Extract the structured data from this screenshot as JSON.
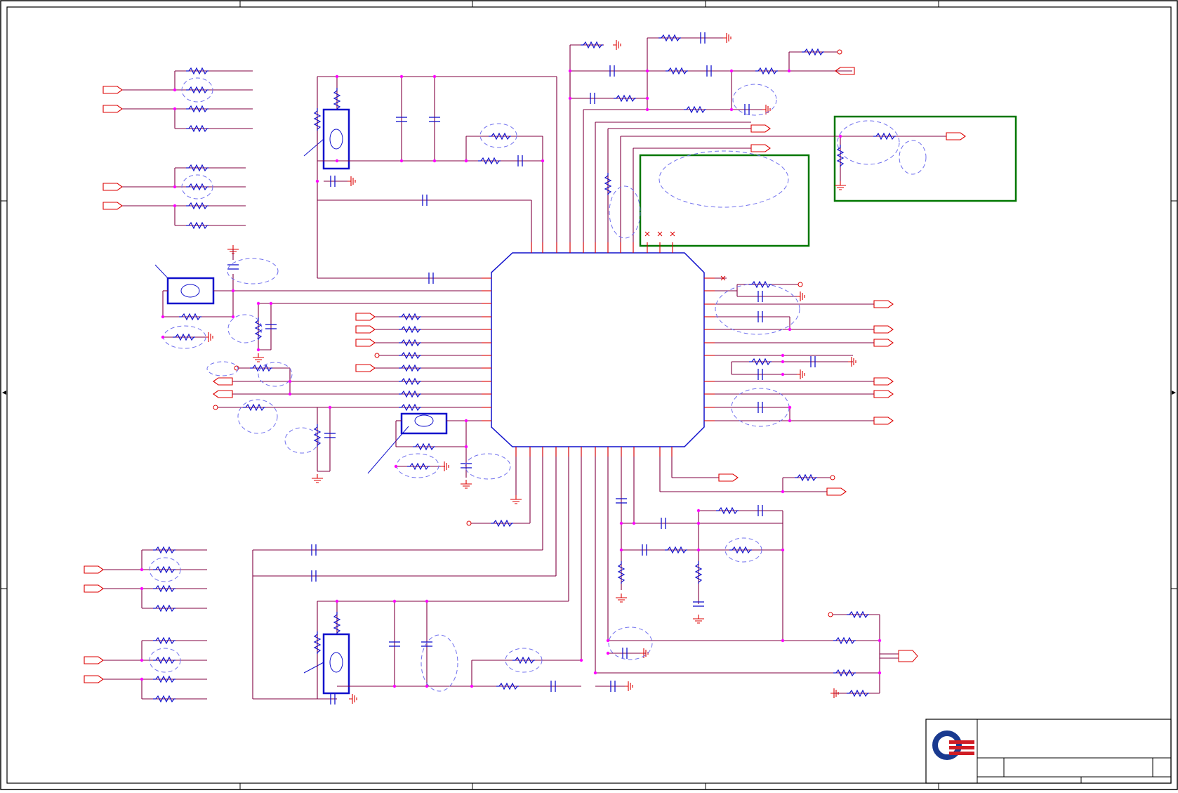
{
  "sheet": {
    "border_color": "#000000",
    "wire_color": "#800040",
    "component_color": "#1010cc",
    "pin_color": "#dd0000",
    "junction_color": "#ff00ff",
    "highlight_color": "#007700",
    "note_color": "#7070ee"
  },
  "title_block": {
    "logo": "brand-logo-icon",
    "logo_colors": {
      "ring": "#1a3a8f",
      "stripes": "#d01c24"
    }
  },
  "components": {
    "main_ic": "qfn-ic-chip",
    "crystals": [
      "crystal-top-left",
      "crystal-left",
      "crystal-center",
      "crystal-bottom-left"
    ],
    "highlight_boxes": [
      "unused-pins-box",
      "right-output-box"
    ]
  }
}
